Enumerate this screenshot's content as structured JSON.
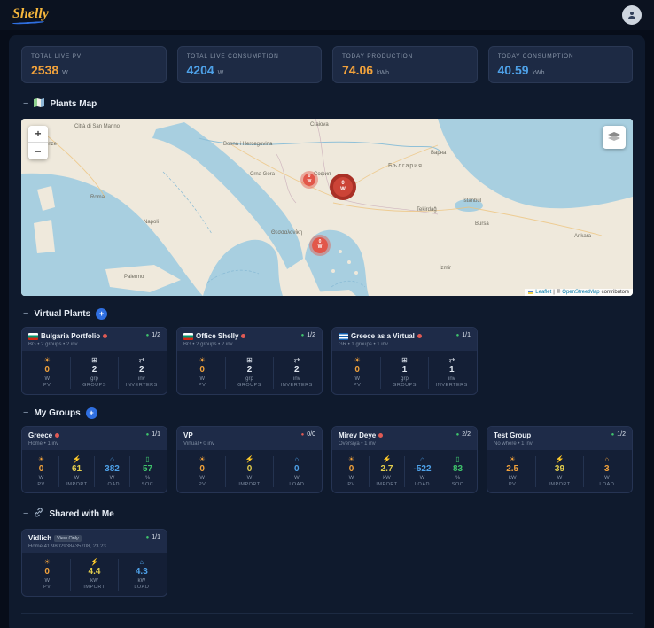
{
  "palette": {
    "orange": "#f2a23b",
    "blue": "#4ea1e8",
    "yellow": "#e4cf4e",
    "green": "#3fc46c",
    "red": "#e05a54",
    "accent_blue": "#2f6fe0"
  },
  "header": {
    "logo": "Shelly"
  },
  "stat_cards": [
    {
      "label": "TOTAL LIVE PV",
      "value": "2538",
      "unit": "W",
      "color": "#f2a23b"
    },
    {
      "label": "TOTAL LIVE CONSUMPTION",
      "value": "4204",
      "unit": "W",
      "color": "#4ea1e8"
    },
    {
      "label": "TODAY PRODUCTION",
      "value": "74.06",
      "unit": "kWh",
      "color": "#f2a23b"
    },
    {
      "label": "TODAY CONSUMPTION",
      "value": "40.59",
      "unit": "kWh",
      "color": "#4ea1e8"
    }
  ],
  "map_section": {
    "collapse": "−",
    "title": "Plants Map",
    "zoom_in": "+",
    "zoom_out": "−",
    "attribution": {
      "leaflet": "Leaflet",
      "separator": "|",
      "copyright": "©",
      "osm": "OpenStreetMap",
      "tail": "contributors"
    },
    "markers": [
      {
        "value": "0",
        "unit": "W"
      },
      {
        "value": "0",
        "unit": "W"
      },
      {
        "value": "0",
        "unit": "W"
      }
    ],
    "labels": [
      "Città di San Marino",
      "Firenze",
      "Roma",
      "Napoli",
      "Palermo",
      "Bosna i Hercegovina",
      "Crna Gora",
      "Craiova",
      "София",
      "България",
      "Варна",
      "İstanbul",
      "Bursa",
      "Ankara",
      "İzmir",
      "Tekirdağ",
      "Θεσσαλονίκη"
    ]
  },
  "virtual_plants": {
    "collapse": "−",
    "title": "Virtual Plants",
    "add": "+",
    "cards": [
      {
        "name": "Bulgaria Portfolio",
        "subtitle": "BG • 2 groups • 2 inv",
        "online": "1/2",
        "dot_color": "#3fc46c",
        "stats": [
          {
            "icon": "☀",
            "value": "0",
            "unit": "W",
            "label": "PV",
            "color": "#f2a23b"
          },
          {
            "icon": "⊞",
            "value": "2",
            "unit": "grp",
            "label": "GROUPS",
            "color": "#dfe6ef"
          },
          {
            "icon": "⇄",
            "value": "2",
            "unit": "inv",
            "label": "INVERTERS",
            "color": "#dfe6ef"
          }
        ]
      },
      {
        "name": "Office Shelly",
        "subtitle": "BG • 2 groups • 2 inv",
        "online": "1/2",
        "dot_color": "#3fc46c",
        "stats": [
          {
            "icon": "☀",
            "value": "0",
            "unit": "W",
            "label": "PV",
            "color": "#f2a23b"
          },
          {
            "icon": "⊞",
            "value": "2",
            "unit": "grp",
            "label": "GROUPS",
            "color": "#dfe6ef"
          },
          {
            "icon": "⇄",
            "value": "2",
            "unit": "inv",
            "label": "INVERTERS",
            "color": "#dfe6ef"
          }
        ]
      },
      {
        "name": "Greece as a Virtual",
        "subtitle": "GR • 1 groups • 1 inv",
        "online": "1/1",
        "dot_color": "#3fc46c",
        "stats": [
          {
            "icon": "☀",
            "value": "0",
            "unit": "W",
            "label": "PV",
            "color": "#f2a23b"
          },
          {
            "icon": "⊞",
            "value": "1",
            "unit": "grp",
            "label": "GROUPS",
            "color": "#dfe6ef"
          },
          {
            "icon": "⇄",
            "value": "1",
            "unit": "inv",
            "label": "INVERTERS",
            "color": "#dfe6ef"
          }
        ]
      }
    ]
  },
  "my_groups": {
    "collapse": "−",
    "title": "My Groups",
    "add": "+",
    "cards": [
      {
        "name": "Greece",
        "subtitle": "Home • 1 inv",
        "online": "1/1",
        "dot_color": "#3fc46c",
        "stats": [
          {
            "icon": "☀",
            "value": "0",
            "unit": "W",
            "label": "PV",
            "color": "#f2a23b"
          },
          {
            "icon": "⚡",
            "value": "61",
            "unit": "W",
            "label": "IMPORT",
            "color": "#e4cf4e"
          },
          {
            "icon": "⌂",
            "value": "382",
            "unit": "W",
            "label": "LOAD",
            "color": "#4ea1e8"
          },
          {
            "icon": "▯",
            "value": "57",
            "unit": "%",
            "label": "SOC",
            "color": "#3fc46c"
          }
        ]
      },
      {
        "name": "VP",
        "subtitle": "Virtual • 0 inv",
        "online": "0/0",
        "dot_color": "#e05a54",
        "stats": [
          {
            "icon": "☀",
            "value": "0",
            "unit": "W",
            "label": "PV",
            "color": "#f2a23b"
          },
          {
            "icon": "⚡",
            "value": "0",
            "unit": "W",
            "label": "IMPORT",
            "color": "#e4cf4e"
          },
          {
            "icon": "⌂",
            "value": "0",
            "unit": "W",
            "label": "LOAD",
            "color": "#4ea1e8"
          }
        ]
      },
      {
        "name": "Mirev Deye",
        "subtitle": "Oversiya • 1 inv",
        "online": "2/2",
        "dot_color": "#3fc46c",
        "stats": [
          {
            "icon": "☀",
            "value": "0",
            "unit": "W",
            "label": "PV",
            "color": "#f2a23b"
          },
          {
            "icon": "⚡",
            "value": "2.7",
            "unit": "kW",
            "label": "IMPORT",
            "color": "#e4cf4e"
          },
          {
            "icon": "⌂",
            "value": "-522",
            "unit": "W",
            "label": "LOAD",
            "color": "#4ea1e8"
          },
          {
            "icon": "▯",
            "value": "83",
            "unit": "%",
            "label": "SOC",
            "color": "#3fc46c"
          }
        ]
      },
      {
        "name": "Test Group",
        "subtitle": "No where • 1 inv",
        "online": "1/2",
        "dot_color": "#3fc46c",
        "stats": [
          {
            "icon": "☀",
            "value": "2.5",
            "unit": "kW",
            "label": "PV",
            "color": "#f2a23b"
          },
          {
            "icon": "⚡",
            "value": "39",
            "unit": "W",
            "label": "IMPORT",
            "color": "#e4cf4e"
          },
          {
            "icon": "⌂",
            "value": "3",
            "unit": "W",
            "label": "LOAD",
            "color": "#f2a23b"
          }
        ]
      }
    ]
  },
  "shared": {
    "collapse": "−",
    "title": "Shared with Me",
    "cards": [
      {
        "name": "Vidlich",
        "badge": "View Only",
        "subtitle": "Home 41.9802938435708, 23.23...",
        "online": "1/1",
        "dot_color": "#3fc46c",
        "stats": [
          {
            "icon": "☀",
            "value": "0",
            "unit": "W",
            "label": "PV",
            "color": "#f2a23b"
          },
          {
            "icon": "⚡",
            "value": "4.4",
            "unit": "kW",
            "label": "IMPORT",
            "color": "#e4cf4e"
          },
          {
            "icon": "⌂",
            "value": "4.3",
            "unit": "kW",
            "label": "LOAD",
            "color": "#4ea1e8"
          }
        ]
      }
    ]
  }
}
